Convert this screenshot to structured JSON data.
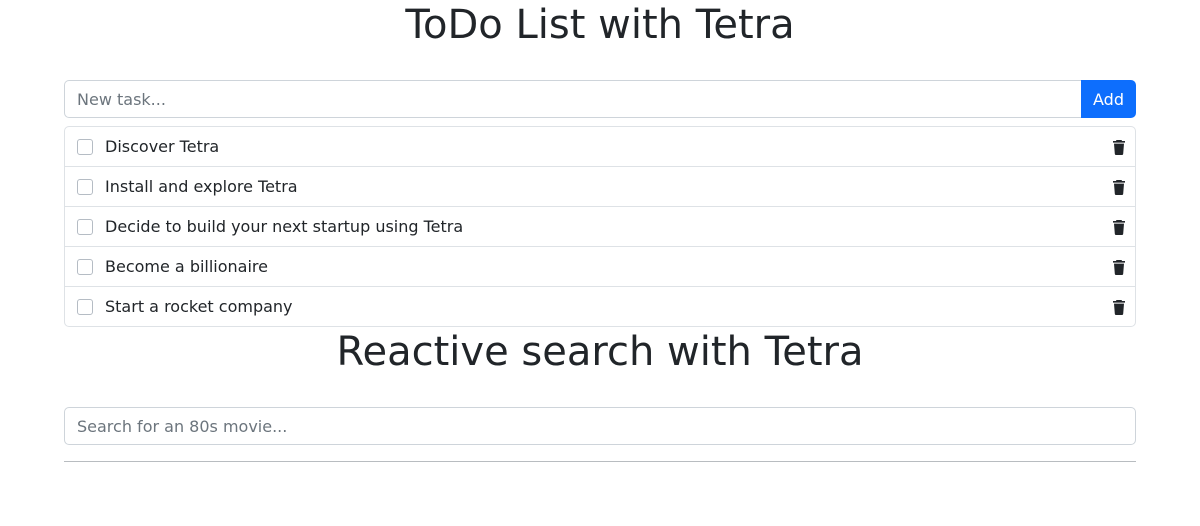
{
  "todo": {
    "title": "ToDo List with Tetra",
    "new_task_placeholder": "New task...",
    "add_label": "Add",
    "items": [
      {
        "text": "Discover Tetra",
        "done": false
      },
      {
        "text": "Install and explore Tetra",
        "done": false
      },
      {
        "text": "Decide to build your next startup using Tetra",
        "done": false
      },
      {
        "text": "Become a billionaire",
        "done": false
      },
      {
        "text": "Start a rocket company",
        "done": false
      }
    ],
    "delete_icon": "trash-icon"
  },
  "search": {
    "title": "Reactive search with Tetra",
    "placeholder": "Search for an 80s movie..."
  },
  "colors": {
    "accent": "#0d6efd",
    "text": "#212529",
    "border": "#dee2e6",
    "placeholder": "#6c757d"
  }
}
